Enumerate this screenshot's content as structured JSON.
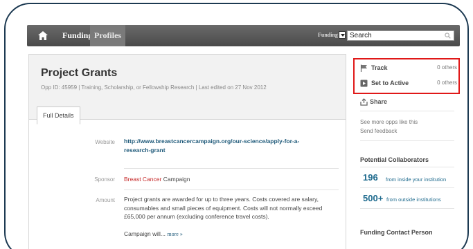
{
  "nav": {
    "funding": "Funding",
    "profiles": "Profiles",
    "scope": "Funding",
    "search_value": "Search"
  },
  "opp": {
    "title": "Project Grants",
    "meta": "Opp ID: 45959  |  Training, Scholarship, or Fellowship Research  |  Last edited on 27 Nov 2012",
    "tab": "Full Details",
    "website_label": "Website",
    "website_line1": "http://www.breastcancercampaign.org/our-science/apply-for-a-",
    "website_line2": "research-grant",
    "sponsor_label": "Sponsor",
    "sponsor_red": "Breast Cancer",
    "sponsor_rest": " Campaign",
    "amount_label": "Amount",
    "amount_text": "Project grants are awarded for up to three years. Costs covered are salary, consumables and small pieces of equipment. Costs will not normally exceed £65,000 per annum (excluding conference travel costs).",
    "campaign_text": "Campaign will...",
    "more": "more »"
  },
  "sidebar": {
    "track": "Track",
    "track_count": "0 others",
    "active": "Set to Active",
    "active_count": "0 others",
    "share": "Share",
    "see_more": "See more opps like this",
    "feedback": "Send feedback",
    "collab_head": "Potential Collaborators",
    "inside_num": "196",
    "inside_txt": "from inside your institution",
    "outside_num": "500+",
    "outside_txt": "from outside institutions",
    "contact_head": "Funding Contact Person"
  },
  "colors": {
    "highlight": "#e01818",
    "link": "#1f5a7a",
    "navbar": "#555555"
  }
}
